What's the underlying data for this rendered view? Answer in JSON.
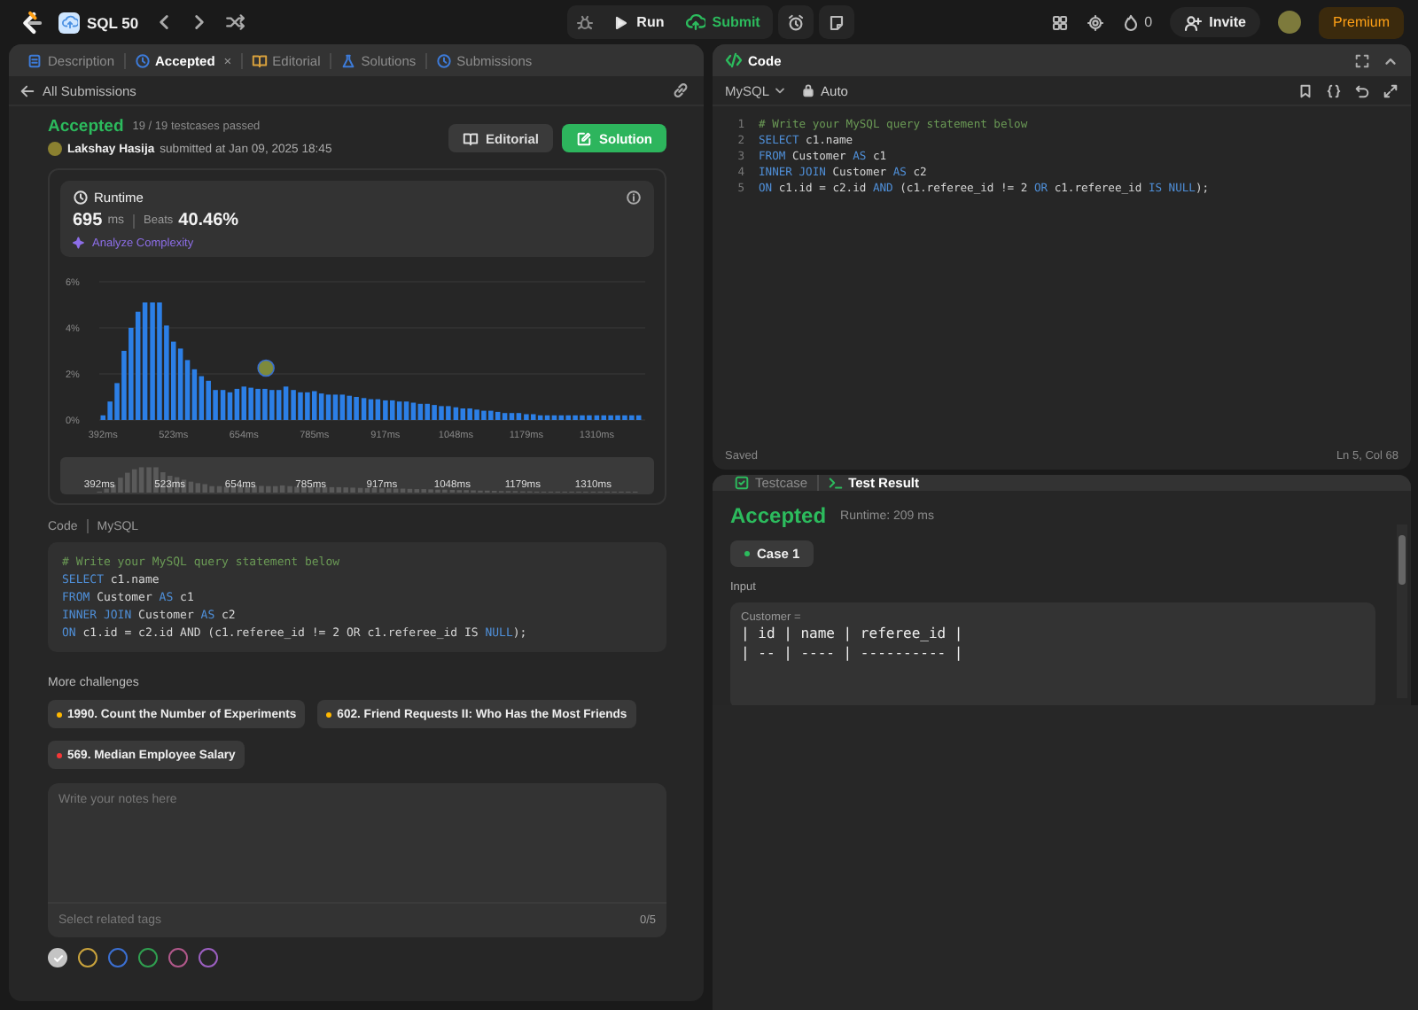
{
  "topbar": {
    "problem_list": "SQL 50",
    "run": "Run",
    "submit": "Submit",
    "streak": "0",
    "invite": "Invite",
    "premium": "Premium"
  },
  "left_tabs": [
    {
      "label": "Description",
      "selected": false
    },
    {
      "label": "Accepted",
      "selected": true,
      "close": "×"
    },
    {
      "label": "Editorial",
      "selected": false
    },
    {
      "label": "Solutions",
      "selected": false
    },
    {
      "label": "Submissions",
      "selected": false
    }
  ],
  "submission": {
    "back": "All Submissions",
    "status": "Accepted",
    "tests": "19 / 19 testcases passed",
    "author": "Lakshay Hasija",
    "submitted": "submitted at Jan 09, 2025 18:45",
    "editorial_button": "Editorial",
    "solution_button": "Solution"
  },
  "runtime": {
    "title": "Runtime",
    "value": "695",
    "unit": "ms",
    "beats_label": "Beats",
    "beats": "40.46%",
    "analyze": "Analyze Complexity",
    "chart_data": {
      "type": "bar",
      "xlim": [
        385,
        1400
      ],
      "ylim": [
        0,
        6
      ],
      "x": [
        392,
        405,
        418,
        431,
        444,
        457,
        470,
        484,
        497,
        510,
        523,
        536,
        549,
        562,
        575,
        588,
        601,
        615,
        628,
        641,
        654,
        667,
        680,
        693,
        706,
        719,
        732,
        746,
        759,
        772,
        785,
        798,
        811,
        824,
        837,
        850,
        863,
        877,
        890,
        903,
        917,
        930,
        943,
        956,
        969,
        982,
        995,
        1008,
        1021,
        1034,
        1048,
        1061,
        1074,
        1087,
        1100,
        1113,
        1126,
        1139,
        1152,
        1165,
        1179,
        1192,
        1205,
        1218,
        1231,
        1244,
        1257,
        1270,
        1283,
        1296,
        1310,
        1323,
        1336,
        1349,
        1362,
        1375,
        1388
      ],
      "values": [
        0.2,
        0.8,
        1.6,
        3.0,
        4.0,
        4.7,
        5.1,
        5.1,
        5.1,
        4.1,
        3.4,
        3.1,
        2.6,
        2.2,
        1.9,
        1.7,
        1.3,
        1.3,
        1.2,
        1.35,
        1.45,
        1.4,
        1.35,
        1.35,
        1.3,
        1.3,
        1.45,
        1.3,
        1.2,
        1.2,
        1.25,
        1.15,
        1.1,
        1.1,
        1.1,
        1.05,
        1.0,
        0.95,
        0.9,
        0.9,
        0.85,
        0.85,
        0.8,
        0.8,
        0.75,
        0.7,
        0.7,
        0.65,
        0.6,
        0.6,
        0.55,
        0.5,
        0.5,
        0.45,
        0.4,
        0.4,
        0.35,
        0.3,
        0.3,
        0.3,
        0.25,
        0.25,
        0.2,
        0.2,
        0.2,
        0.2,
        0.2,
        0.2,
        0.2,
        0.2,
        0.2,
        0.2,
        0.2,
        0.2,
        0.2,
        0.2,
        0.2
      ],
      "yticks": [
        {
          "value": 0,
          "label": "0%"
        },
        {
          "value": 2,
          "label": "2%"
        },
        {
          "value": 4,
          "label": "4%"
        },
        {
          "value": 6,
          "label": "6%"
        }
      ],
      "xticks": [
        {
          "value": 392,
          "label": "392ms"
        },
        {
          "value": 523,
          "label": "523ms"
        },
        {
          "value": 654,
          "label": "654ms"
        },
        {
          "value": 785,
          "label": "785ms"
        },
        {
          "value": 917,
          "label": "917ms"
        },
        {
          "value": 1048,
          "label": "1048ms"
        },
        {
          "value": 1179,
          "label": "1179ms"
        },
        {
          "value": 1310,
          "label": "1310ms"
        }
      ]
    },
    "overview_labels": [
      "392ms",
      "523ms",
      "654ms",
      "785ms",
      "917ms",
      "1048ms",
      "1179ms",
      "1310ms"
    ]
  },
  "code_section": {
    "label": "Code",
    "language": "MySQL",
    "lines": [
      [
        {
          "kind": "comment",
          "text": "# Write your MySQL query statement below"
        }
      ],
      [
        {
          "kind": "keyword",
          "text": "SELECT"
        },
        {
          "kind": "plain",
          "text": " c1.name"
        }
      ],
      [
        {
          "kind": "keyword",
          "text": "FROM"
        },
        {
          "kind": "plain",
          "text": " Customer "
        },
        {
          "kind": "keyword",
          "text": "AS"
        },
        {
          "kind": "plain",
          "text": " c1"
        }
      ],
      [
        {
          "kind": "keyword",
          "text": "INNER JOIN"
        },
        {
          "kind": "plain",
          "text": " Customer "
        },
        {
          "kind": "keyword",
          "text": "AS"
        },
        {
          "kind": "plain",
          "text": " c2"
        }
      ],
      [
        {
          "kind": "keyword",
          "text": "ON"
        },
        {
          "kind": "plain",
          "text": " c1.id = c2.id AND (c1.referee_id != 2 OR c1.referee_id IS "
        },
        {
          "kind": "keyword",
          "text": "NULL"
        },
        {
          "kind": "plain",
          "text": ");"
        }
      ]
    ]
  },
  "more_challenges": {
    "title": "More challenges",
    "items": [
      {
        "label": "1990. Count the Number of Experiments",
        "color": "#ffb800"
      },
      {
        "label": "602. Friend Requests II: Who Has the Most Friends",
        "color": "#ffb800"
      },
      {
        "label": "569. Median Employee Salary",
        "color": "#f63737"
      }
    ]
  },
  "notes": {
    "placeholder": "Write your notes here",
    "tags_placeholder": "Select related tags",
    "tag_count": "0/5",
    "colors": [
      {
        "color": "#c4c4c4",
        "selected": true
      },
      {
        "color": "#c8a23c",
        "selected": false
      },
      {
        "color": "#3b6fd1",
        "selected": false
      },
      {
        "color": "#2f9e4f",
        "selected": false
      },
      {
        "color": "#b0588a",
        "selected": false
      },
      {
        "color": "#9b5fc0",
        "selected": false
      }
    ]
  },
  "editor": {
    "title": "Code",
    "language": "MySQL",
    "mode": "Auto",
    "status": "Saved",
    "cursor": "Ln 5, Col 68",
    "lines": [
      {
        "number": "1",
        "tokens": [
          {
            "kind": "comment",
            "text": "# Write your MySQL query statement below"
          }
        ]
      },
      {
        "number": "2",
        "tokens": [
          {
            "kind": "keyword",
            "text": "SELECT"
          },
          {
            "kind": "plain",
            "text": " c1.name"
          }
        ]
      },
      {
        "number": "3",
        "tokens": [
          {
            "kind": "keyword",
            "text": "FROM"
          },
          {
            "kind": "plain",
            "text": " Customer "
          },
          {
            "kind": "keyword",
            "text": "AS"
          },
          {
            "kind": "plain",
            "text": " c1"
          }
        ]
      },
      {
        "number": "4",
        "tokens": [
          {
            "kind": "keyword",
            "text": "INNER JOIN"
          },
          {
            "kind": "plain",
            "text": " Customer "
          },
          {
            "kind": "keyword",
            "text": "AS"
          },
          {
            "kind": "plain",
            "text": " c2"
          }
        ]
      },
      {
        "number": "5",
        "tokens": [
          {
            "kind": "keyword",
            "text": "ON"
          },
          {
            "kind": "plain",
            "text": " c1.id = c2.id "
          },
          {
            "kind": "keyword",
            "text": "AND"
          },
          {
            "kind": "plain",
            "text": " (c1.referee_id != 2 "
          },
          {
            "kind": "keyword",
            "text": "OR"
          },
          {
            "kind": "plain",
            "text": " c1.referee_id "
          },
          {
            "kind": "keyword",
            "text": "IS NULL"
          },
          {
            "kind": "plain",
            "text": ");"
          }
        ]
      }
    ]
  },
  "test_panel": {
    "tabs": [
      {
        "label": "Testcase",
        "selected": false
      },
      {
        "label": "Test Result",
        "selected": true
      }
    ],
    "status": "Accepted",
    "runtime": "Runtime: 209 ms",
    "cases": [
      {
        "label": "Case 1",
        "selected": true
      }
    ],
    "input_label": "Input",
    "variable": "Customer =",
    "table_lines": [
      "| id | name | referee_id |",
      "| -- | ---- | ---------- |"
    ]
  }
}
